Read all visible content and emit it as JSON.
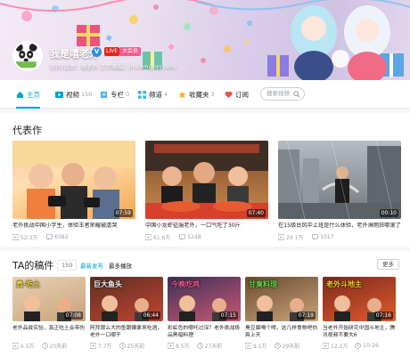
{
  "user": {
    "name": "我是嘻老外",
    "verify_badge": "V",
    "live_badge": "LIVE",
    "vip_badge": "大会员",
    "subtitle": "微信/微博：嘻老外   工作邮箱：jh.com@qq.com",
    "avatar_label": "嘻老外"
  },
  "nav": {
    "tabs": [
      {
        "label": "主页",
        "count": "",
        "icon": "home-icon"
      },
      {
        "label": "视频",
        "count": "150",
        "icon": "video-icon"
      },
      {
        "label": "专栏",
        "count": "0",
        "icon": "column-icon"
      },
      {
        "label": "频道",
        "count": "4",
        "icon": "channel-icon"
      },
      {
        "label": "收藏夹",
        "count": "3",
        "icon": "favorites-icon"
      },
      {
        "label": "订阅",
        "count": "",
        "icon": "subscribe-icon"
      }
    ],
    "search_placeholder": "搜索视频"
  },
  "representative": {
    "title": "代表作",
    "videos": [
      {
        "title": "老外挑战中国小学生，体验王者荣耀被虐哭",
        "views": "52.3万",
        "comments": "6582",
        "duration": "07:59"
      },
      {
        "title": "中国小龙虾征服老外，一口气吃了30斤",
        "views": "61.6万",
        "comments": "5248",
        "duration": "07:40"
      },
      {
        "title": "在15级台风中上班是什么体验，老外淋雨狂哪滚了",
        "views": "29.1万",
        "comments": "1017",
        "duration": "00:10"
      }
    ]
  },
  "uploads": {
    "title": "TA的稿件",
    "count": "150",
    "sort_latest": "最新发布",
    "sort_popular": "最多播放",
    "more_label": "更多",
    "videos": [
      {
        "title": "老外品尝实验，真正吃土会带伤",
        "views": "6.5万",
        "time": "20天前",
        "duration": "07:08",
        "caption": "真·吃土"
      },
      {
        "title": "阿拜那么大的鱼跟鑽拿来吃酒，老外一口哪干",
        "views": "7.7万",
        "time": "25天前",
        "duration": "06:44",
        "caption": "巨大鱼头"
      },
      {
        "title": "彩虹色的哪吒过深？老外挑战极品黑暗料理",
        "views": "8.5万",
        "time": "27天前",
        "duration": "07:15",
        "caption": "今晚吃鸡"
      },
      {
        "title": "臭豆腐喝个啤，这几样食物吧你爽上天",
        "views": "9.1万",
        "time": "29天前",
        "duration": "07:19",
        "caption": "甘臭料理"
      },
      {
        "title": "当老外开始研究中国斗地主，腾讯视频不要大6",
        "views": "12.2万",
        "time": "10-26",
        "duration": "07:16",
        "caption": "老外斗地主"
      }
    ]
  },
  "colors": {
    "accent": "#00a1d6",
    "pink": "#f25d8e",
    "live": "#e2261c"
  }
}
